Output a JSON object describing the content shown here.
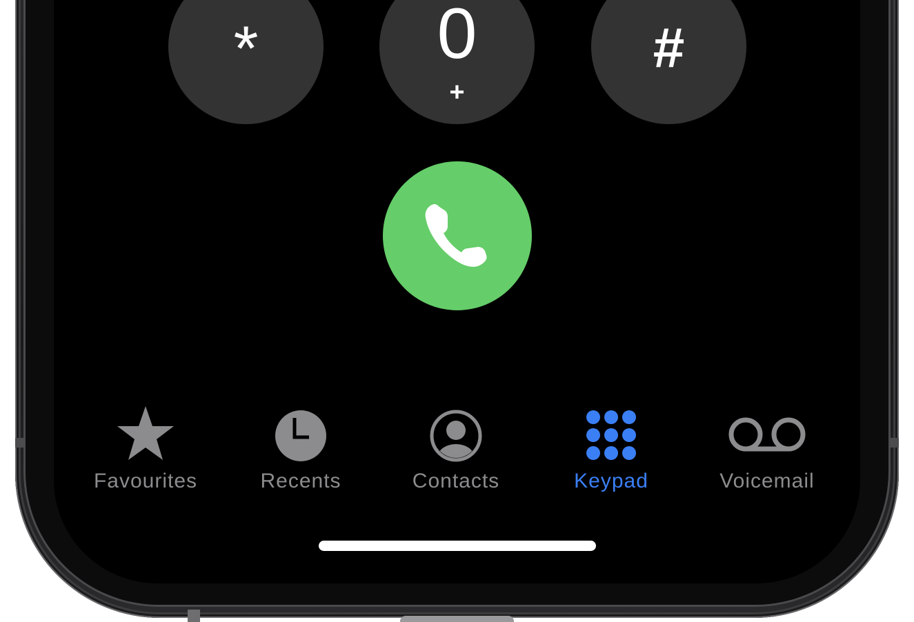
{
  "keypad": {
    "keys": [
      {
        "main": "*",
        "sub": ""
      },
      {
        "main": "0",
        "sub": "+"
      },
      {
        "main": "#",
        "sub": ""
      }
    ]
  },
  "call_button": {
    "icon": "phone-icon",
    "color": "#65cd69"
  },
  "tabbar": {
    "tabs": [
      {
        "label": "Favourites",
        "icon": "star-icon",
        "active": false
      },
      {
        "label": "Recents",
        "icon": "clock-icon",
        "active": false
      },
      {
        "label": "Contacts",
        "icon": "person-circle-icon",
        "active": false
      },
      {
        "label": "Keypad",
        "icon": "keypad-grid-icon",
        "active": true
      },
      {
        "label": "Voicemail",
        "icon": "voicemail-icon",
        "active": false
      }
    ],
    "active_color": "#3b7ff5",
    "inactive_color": "#8c8c8e"
  }
}
